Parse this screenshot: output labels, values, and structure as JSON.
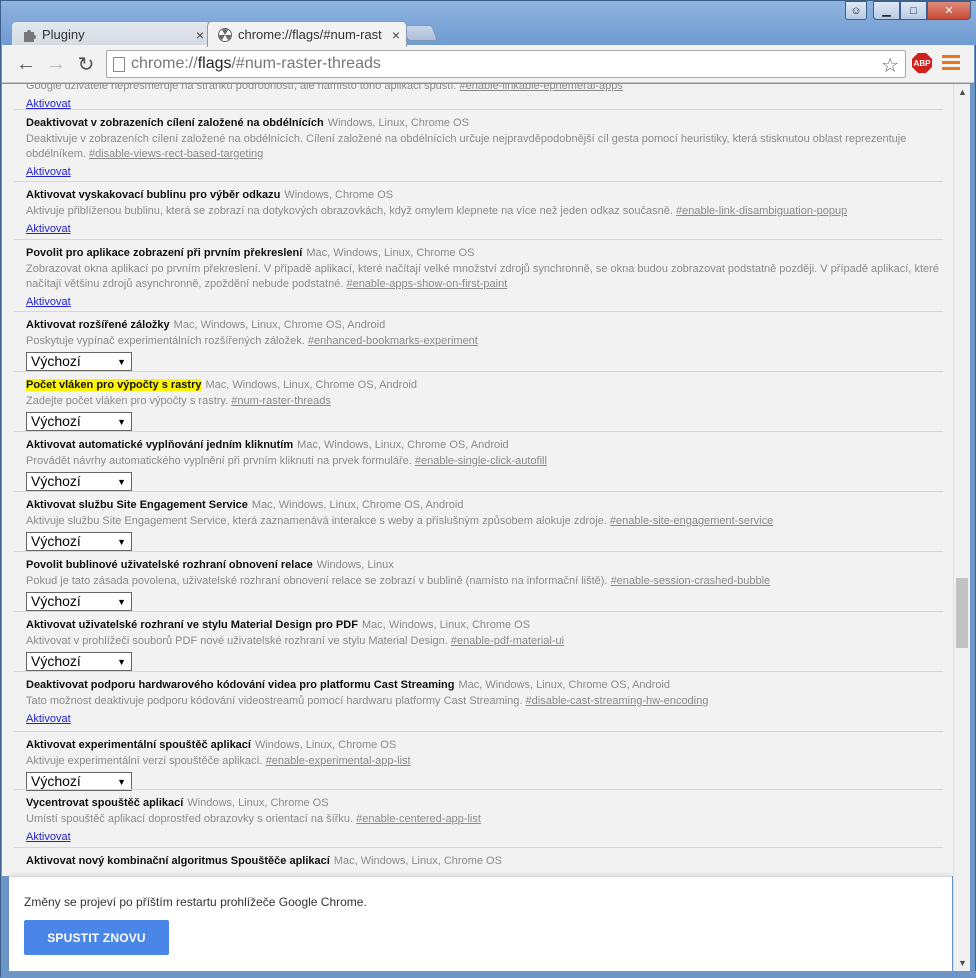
{
  "tabs": [
    {
      "label": "Pluginy",
      "icon": "puzzle-icon"
    },
    {
      "label": "chrome://flags/#num-rast",
      "icon": "radiation-icon"
    }
  ],
  "window_buttons": {
    "user": "☺",
    "minimize": "▁",
    "maximize": "□",
    "close": "✕"
  },
  "toolbar": {
    "back": "←",
    "forward": "→",
    "reload": "↻",
    "url_scheme": "chrome://",
    "url_host": "flags",
    "url_rest": "/#num-raster-threads",
    "star": "☆",
    "abp": "ABP"
  },
  "flags": [
    {
      "title": "",
      "platforms": "",
      "desc": "Google uživatele nepřesměruje na stránku podrobností, ale namísto toho aplikaci spustí.",
      "hash": "#enable-linkable-ephemeral-apps",
      "control": "link",
      "control_label": "Aktivovat"
    },
    {
      "title": "Deaktivovat v zobrazeních cílení založené na obdélnících",
      "platforms": "Windows, Linux, Chrome OS",
      "desc": "Deaktivuje v zobrazeních cílení založené na obdélnících. Cílení založené na obdélnících určuje nejpravděpodobnější cíl gesta pomocí heuristiky, která stisknutou oblast reprezentuje obdélníkem.",
      "hash": "#disable-views-rect-based-targeting",
      "control": "link",
      "control_label": "Aktivovat"
    },
    {
      "title": "Aktivovat vyskakovací bublinu pro výběr odkazu",
      "platforms": "Windows, Chrome OS",
      "desc": "Aktivuje přiblíženou bublinu, která se zobrazí na dotykových obrazovkách, když omylem klepnete na více než jeden odkaz současně.",
      "hash": "#enable-link-disambiguation-popup",
      "control": "link",
      "control_label": "Aktivovat"
    },
    {
      "title": "Povolit pro aplikace zobrazení při prvním překreslení",
      "platforms": "Mac, Windows, Linux, Chrome OS",
      "desc": "Zobrazovat okna aplikací po prvním překreslení. V případě aplikací, které načítají velké množství zdrojů synchronně, se okna budou zobrazovat podstatně později. V případě aplikací, které načítají většinu zdrojů asynchronně, zpoždění nebude podstatné.",
      "hash": "#enable-apps-show-on-first-paint",
      "control": "link",
      "control_label": "Aktivovat"
    },
    {
      "title": "Aktivovat rozšířené záložky",
      "platforms": "Mac, Windows, Linux, Chrome OS, Android",
      "desc": "Poskytuje vypínač experimentálních rozšířených záložek.",
      "hash": "#enhanced-bookmarks-experiment",
      "control": "select",
      "control_label": "Výchozí"
    },
    {
      "title": "Počet vláken pro výpočty s rastry",
      "platforms": "Mac, Windows, Linux, Chrome OS, Android",
      "desc": "Zadejte počet vláken pro výpočty s rastry.",
      "hash": "#num-raster-threads",
      "control": "select",
      "control_label": "Výchozí",
      "highlight": true
    },
    {
      "title": "Aktivovat automatické vyplňování jedním kliknutím",
      "platforms": "Mac, Windows, Linux, Chrome OS, Android",
      "desc": "Provádět návrhy automatického vyplnění při prvním kliknutí na prvek formuláře.",
      "hash": "#enable-single-click-autofill",
      "control": "select",
      "control_label": "Výchozí"
    },
    {
      "title": "Aktivovat službu Site Engagement Service",
      "platforms": "Mac, Windows, Linux, Chrome OS, Android",
      "desc": "Aktivuje službu Site Engagement Service, která zaznamenává interakce s weby a příslušným způsobem alokuje zdroje.",
      "hash": "#enable-site-engagement-service",
      "control": "select",
      "control_label": "Výchozí"
    },
    {
      "title": "Povolit bublinové uživatelské rozhraní obnovení relace",
      "platforms": "Windows, Linux",
      "desc": "Pokud je tato zásada povolena, uživatelské rozhraní obnovení relace se zobrazí v bublině (namísto na informační liště).",
      "hash": "#enable-session-crashed-bubble",
      "control": "select",
      "control_label": "Výchozí"
    },
    {
      "title": "Aktivovat uživatelské rozhraní ve stylu Material Design pro PDF",
      "platforms": "Mac, Windows, Linux, Chrome OS",
      "desc": "Aktivovat v prohlížeči souborů PDF nové uživatelské rozhraní ve stylu Material Design.",
      "hash": "#enable-pdf-material-ui",
      "control": "select",
      "control_label": "Výchozí"
    },
    {
      "title": "Deaktivovat podporu hardwarového kódování videa pro platformu Cast Streaming",
      "platforms": "Mac, Windows, Linux, Chrome OS, Android",
      "desc": "Tato možnost deaktivuje podporu kódování videostreamů pomocí hardwaru platformy Cast Streaming.",
      "hash": "#disable-cast-streaming-hw-encoding",
      "control": "link",
      "control_label": "Aktivovat"
    },
    {
      "title": "Aktivovat experimentální spouštěč aplikací",
      "platforms": "Windows, Linux, Chrome OS",
      "desc": "Aktivuje experimentální verzi spouštěče aplikací.",
      "hash": "#enable-experimental-app-list",
      "control": "select",
      "control_label": "Výchozí"
    },
    {
      "title": "Vycentrovat spouštěč aplikací",
      "platforms": "Windows, Linux, Chrome OS",
      "desc": "Umístí spouštěč aplikací doprostřed obrazovky s orientací na šířku.",
      "hash": "#enable-centered-app-list",
      "control": "link",
      "control_label": "Aktivovat"
    },
    {
      "title": "Aktivovat nový kombinační algoritmus Spouštěče aplikací",
      "platforms": "Mac, Windows, Linux, Chrome OS",
      "desc": "",
      "hash": "",
      "control": "none",
      "control_label": ""
    }
  ],
  "footer": {
    "message": "Změny se projeví po příštím restartu prohlížeče Google Chrome.",
    "button": "SPUSTIT ZNOVU"
  },
  "colors": {
    "accent": "#4a86e8",
    "highlight": "#fff700",
    "link": "#2222cc"
  }
}
